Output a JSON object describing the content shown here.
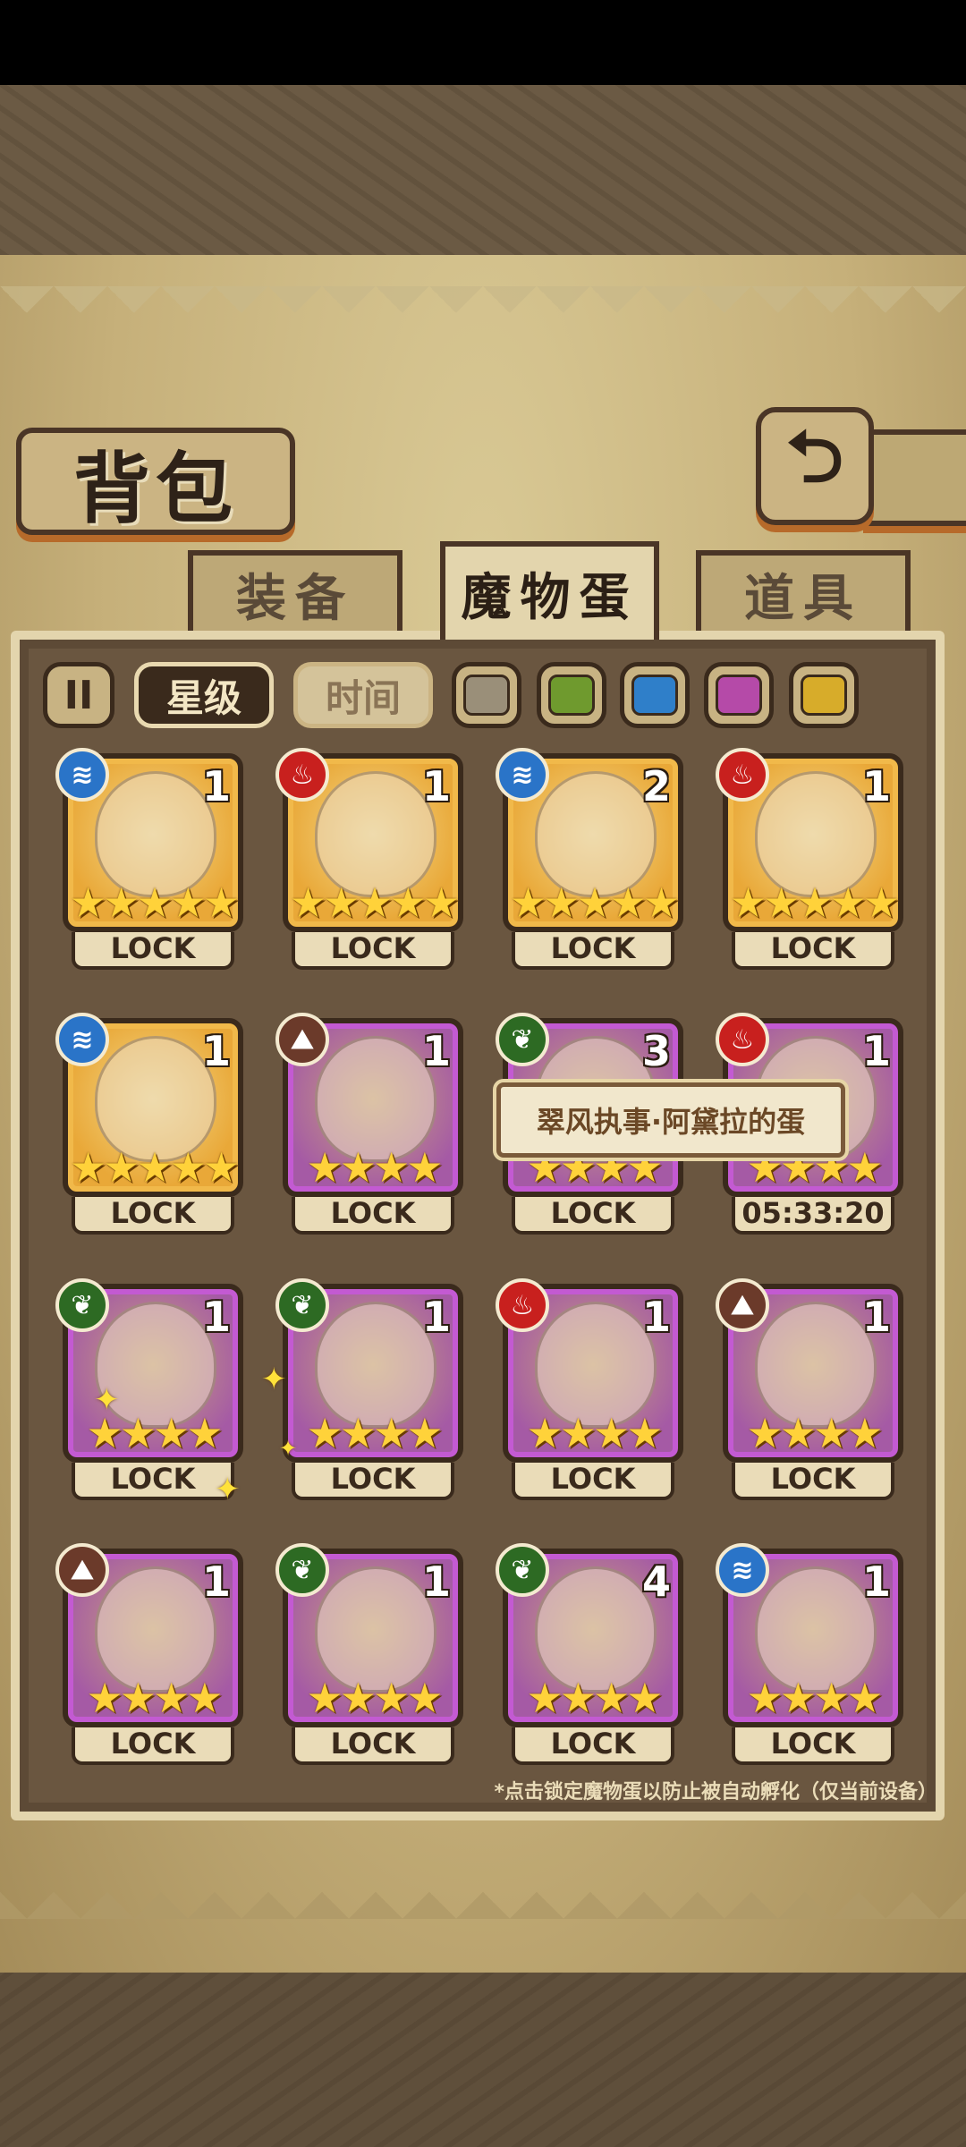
{
  "screen": {
    "title": "背包",
    "back_icon": "return-arrow-icon"
  },
  "tabs": [
    {
      "label": "装备",
      "active": false
    },
    {
      "label": "魔物蛋",
      "active": true
    },
    {
      "label": "道具",
      "active": false
    }
  ],
  "filters": {
    "pause_label": "II",
    "sort_star": "星级",
    "sort_time": "时间",
    "colors": [
      "#9a8f79",
      "#6f9a2e",
      "#2f7fc9",
      "#b54aa8",
      "#d7ac2a"
    ]
  },
  "eggs": [
    {
      "element": "water",
      "count": "1",
      "stars": "★★★★★",
      "rarity": "gold",
      "status": "LOCK"
    },
    {
      "element": "fire",
      "count": "1",
      "stars": "★★★★★",
      "rarity": "gold",
      "status": "LOCK"
    },
    {
      "element": "water",
      "count": "2",
      "stars": "★★★★★",
      "rarity": "gold",
      "status": "LOCK"
    },
    {
      "element": "fire",
      "count": "1",
      "stars": "★★★★★",
      "rarity": "gold",
      "status": "LOCK"
    },
    {
      "element": "water",
      "count": "1",
      "stars": "★★★★★",
      "rarity": "gold",
      "status": "LOCK"
    },
    {
      "element": "earth",
      "count": "1",
      "stars": "★★★★",
      "rarity": "purple",
      "status": "LOCK"
    },
    {
      "element": "nature",
      "count": "3",
      "stars": "★★★★",
      "rarity": "purple",
      "status": "LOCK"
    },
    {
      "element": "fire",
      "count": "1",
      "stars": "★★★★",
      "rarity": "purple",
      "status": "05:33:20"
    },
    {
      "element": "nature",
      "count": "1",
      "stars": "★★★★",
      "rarity": "purple",
      "status": "LOCK"
    },
    {
      "element": "nature",
      "count": "1",
      "stars": "★★★★",
      "rarity": "purple",
      "status": "LOCK"
    },
    {
      "element": "fire",
      "count": "1",
      "stars": "★★★★",
      "rarity": "purple",
      "status": "LOCK"
    },
    {
      "element": "earth",
      "count": "1",
      "stars": "★★★★",
      "rarity": "purple",
      "status": "LOCK"
    },
    {
      "element": "earth",
      "count": "1",
      "stars": "★★★★",
      "rarity": "purple",
      "status": "LOCK"
    },
    {
      "element": "nature",
      "count": "1",
      "stars": "★★★★",
      "rarity": "purple",
      "status": "LOCK"
    },
    {
      "element": "nature",
      "count": "4",
      "stars": "★★★★",
      "rarity": "purple",
      "status": "LOCK"
    },
    {
      "element": "water",
      "count": "1",
      "stars": "★★★★",
      "rarity": "purple",
      "status": "LOCK"
    }
  ],
  "tooltip": "翠风执事·阿黛拉的蛋",
  "footnote": "*点击锁定魔物蛋以防止被自动孵化（仅当前设备）"
}
